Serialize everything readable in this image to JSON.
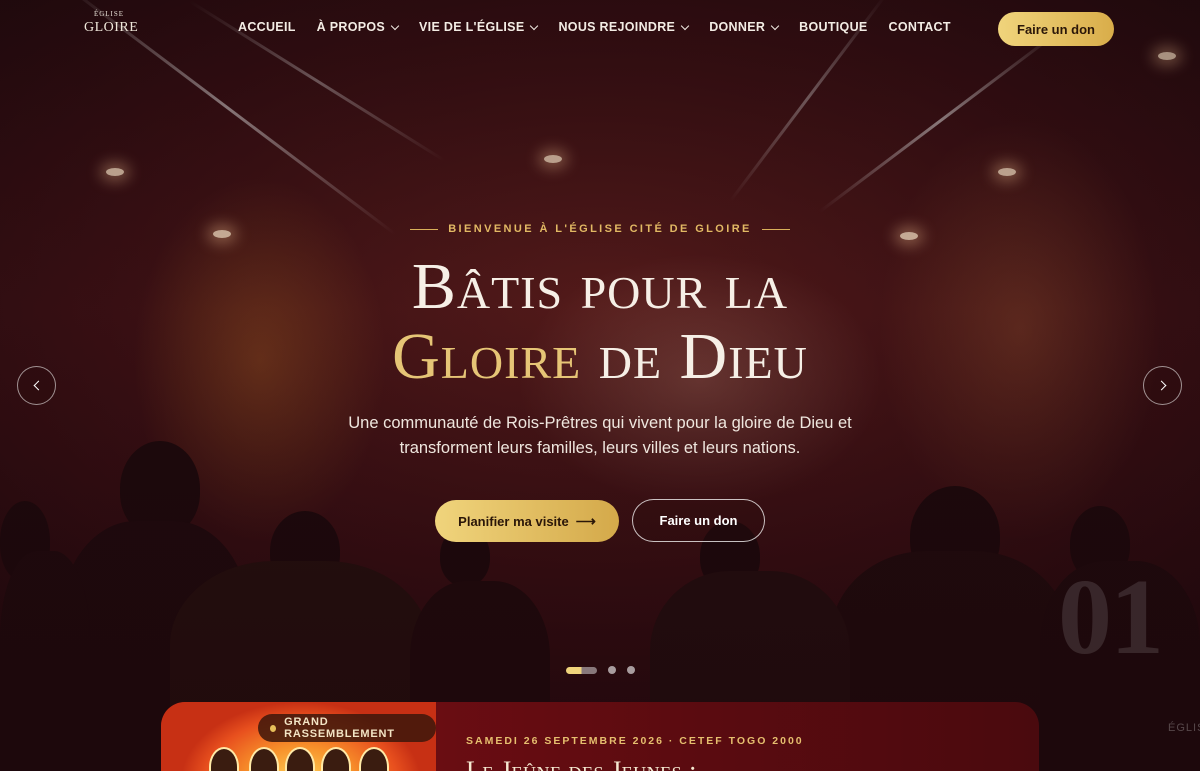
{
  "brand": {
    "logo_top": "ÉGLISE",
    "logo_main": "GLOIRE"
  },
  "nav": {
    "items": [
      {
        "label": "ACCUEIL",
        "dropdown": false
      },
      {
        "label": "À PROPOS",
        "dropdown": true
      },
      {
        "label": "VIE DE L'ÉGLISE",
        "dropdown": true
      },
      {
        "label": "NOUS REJOINDRE",
        "dropdown": true
      },
      {
        "label": "DONNER",
        "dropdown": true
      },
      {
        "label": "BOUTIQUE",
        "dropdown": false
      },
      {
        "label": "CONTACT",
        "dropdown": false
      }
    ],
    "donate_label": "Faire un don"
  },
  "hero": {
    "eyebrow": "BIENVENUE À L'ÉGLISE CITÉ DE GLOIRE",
    "title_line1": "Bâtis pour la",
    "title_gold": "Gloire",
    "title_rest": " de Dieu",
    "subtitle": "Une communauté de Rois-Prêtres qui vivent pour la gloire de Dieu et transforment leurs familles, leurs villes et leurs nations.",
    "cta_primary": "Planifier ma visite",
    "cta_primary_arrow": "⟶",
    "cta_secondary": "Faire un don",
    "slide_number": "01",
    "slides_total": 3,
    "active_slide": 1
  },
  "edge_label": "ÉGLIS",
  "event": {
    "badge": "GRAND RASSEMBLEMENT",
    "meta": "SAMEDI 26 SEPTEMBRE 2026 · CETEF TOGO 2000",
    "title": "Le Jeûne des Jeunes :"
  },
  "colors": {
    "gold": "#e6c576",
    "accent_button": "#e5c066",
    "event_bg": "#6a0d12"
  },
  "icons": {
    "prev": "chevron-left-icon",
    "next": "chevron-right-icon",
    "dropdown": "chevron-down-icon",
    "cta_arrow": "arrow-right-icon"
  }
}
